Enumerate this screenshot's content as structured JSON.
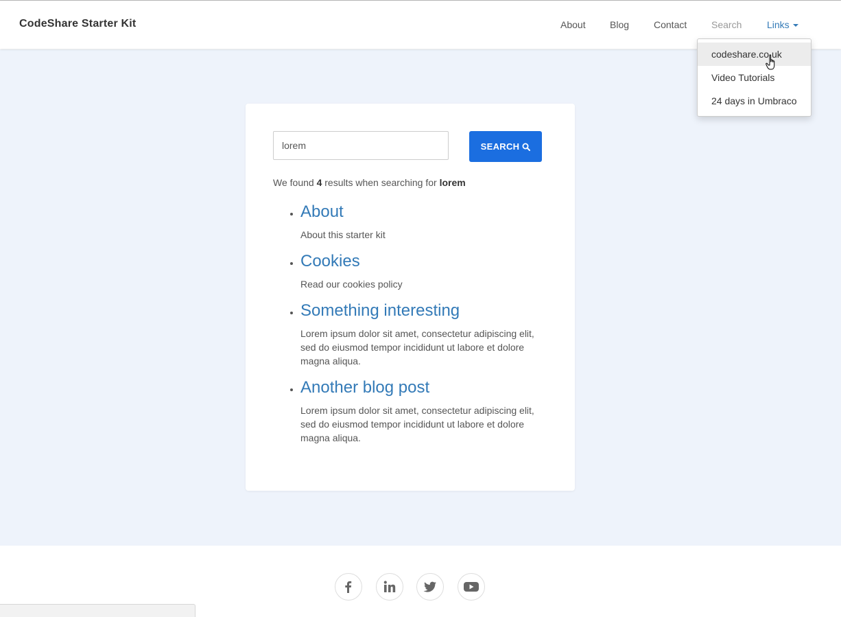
{
  "navbar": {
    "brand": "CodeShare Starter Kit",
    "links": [
      {
        "label": "About"
      },
      {
        "label": "Blog"
      },
      {
        "label": "Contact"
      },
      {
        "label": "Search"
      },
      {
        "label": "Links"
      }
    ]
  },
  "dropdown": {
    "items": [
      {
        "label": "codeshare.co.uk"
      },
      {
        "label": "Video Tutorials"
      },
      {
        "label": "24 days in Umbraco"
      }
    ]
  },
  "search": {
    "value": "lorem",
    "button_label": "SEARCH",
    "summary_prefix": "We found",
    "count": "4",
    "summary_middle": "results when searching for",
    "term": "lorem"
  },
  "results": [
    {
      "title": "About",
      "description": "About this starter kit"
    },
    {
      "title": "Cookies",
      "description": "Read our cookies policy"
    },
    {
      "title": "Something interesting",
      "description": "Lorem ipsum dolor sit amet, consectetur adipiscing elit, sed do eiusmod tempor incididunt ut labore et dolore magna aliqua."
    },
    {
      "title": "Another blog post",
      "description": "Lorem ipsum dolor sit amet, consectetur adipiscing elit, sed do eiusmod tempor incididunt ut labore et dolore magna aliqua."
    }
  ],
  "footer": {
    "social": [
      "facebook-icon",
      "linkedin-icon",
      "twitter-icon",
      "youtube-icon"
    ]
  },
  "colors": {
    "accent": "#1b6ee0",
    "link": "#337ab7",
    "background": "#eef3fb",
    "dropdown_hover": "#ececec"
  }
}
